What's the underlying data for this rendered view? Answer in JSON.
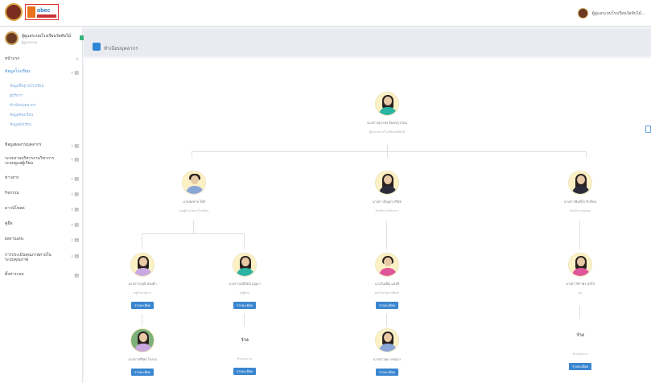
{
  "top_user": {
    "name": "ผู้ดูแลระบบโรงเรียนวัดทับไม้..."
  },
  "sidebar": {
    "user_name": "ผู้ดูแลระบบโรงเรียนวัดทับไม้",
    "user_sub": "ผู้ดูแลระบบ",
    "items": [
      {
        "label": "หน้าแรก",
        "icon": "home-icon"
      },
      {
        "label": "ข้อมูลโรงเรียน",
        "icon": "school-icon"
      },
      {
        "label": "ข้อมูลผลงานบุคลากร",
        "icon": "file-icon"
      },
      {
        "label": "ระบบงานบริหารงานวิชาการ ระบบดูแลผู้เรียน",
        "icon": "book-icon"
      },
      {
        "label": "ข่าวสาร",
        "icon": "news-icon"
      },
      {
        "label": "กิจกรรม",
        "icon": "calendar-icon"
      },
      {
        "label": "ดาวน์โหลด",
        "icon": "download-icon"
      },
      {
        "label": "คู่มือ",
        "icon": "manual-icon"
      },
      {
        "label": "ผลงานเด่น",
        "icon": "star-icon"
      },
      {
        "label": "การประเมินคุณภาพภายใน ระบบคุณภาพ",
        "icon": "chart-icon"
      },
      {
        "label": "ตั้งค่าระบบ",
        "icon": "gear-icon"
      }
    ],
    "subitems": [
      "ข้อมูลพื้นฐานโรงเรียน",
      "ผู้บริหาร",
      "ทำเนียบบุคลากร",
      "ข้อมูลห้องเรียน",
      "ข้อมูลนักเรียน"
    ]
  },
  "page": {
    "title": "ทำเนียบบุคลากร"
  },
  "org": {
    "root": {
      "name": "นางสาวสุภาพร อินทรสุวรรณ",
      "pos": "ผู้อำนวยการโรงเรียนวัดทับไม้"
    },
    "level2": [
      {
        "name": "นายสมชาย ใจดี",
        "pos": "รองผู้อำนวยการโรงเรียน"
      },
      {
        "name": "นางสาวกัญญา ศรีสุข",
        "pos": "หัวหน้างานวิชาการ"
      },
      {
        "name": "นางสาวพิมพ์ใจ รักเรียน",
        "pos": "หัวหน้างานบุคคล"
      }
    ],
    "level3": [
      {
        "name": "นางสาวอรุณี ทองคำ",
        "pos": "ครูชำนาญการ",
        "btn": "รายละเอียด"
      },
      {
        "name": "นางสาวมณีรัตน์ บุญมา",
        "pos": "ครูผู้ช่วย",
        "btn": "รายละเอียด"
      },
      {
        "name": "นางวันเพ็ญ แสงดี",
        "pos": "ครูชำนาญการพิเศษ",
        "btn": "รายละเอียด"
      },
      {
        "name": "นางสาวจิราพร สุขใจ",
        "pos": "ครู",
        "btn": "รายละเอียด"
      }
    ],
    "level4": [
      {
        "name": "นางสาวศิริพร ใจงาม",
        "pos": "ครูอัตราจ้าง",
        "btn": "รายละเอียด"
      },
      {
        "name": "ว่าง",
        "pos": "ตำแหน่งว่าง",
        "btn": "รายละเอียด",
        "empty": "ว่าง"
      },
      {
        "name": "นางสาวสุดา พรมมา",
        "pos": "พี่เลี้ยงเด็ก",
        "btn": "รายละเอียด"
      },
      {
        "name": "ว่าง",
        "pos": "ตำแหน่งว่าง",
        "btn": "รายละเอียด",
        "empty": "ว่าง"
      }
    ]
  }
}
